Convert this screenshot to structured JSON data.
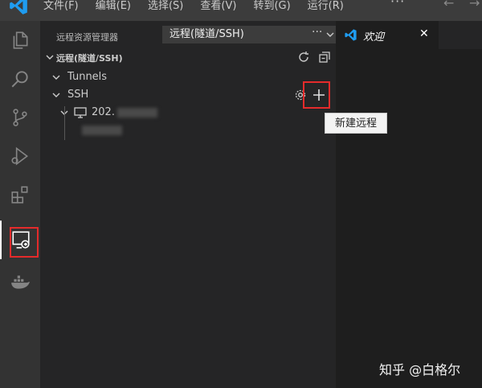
{
  "menu": [
    "文件(F)",
    "编辑(E)",
    "选择(S)",
    "查看(V)",
    "转到(G)",
    "运行(R)"
  ],
  "menu_overflow": "···",
  "activity_items": [
    "explorer-icon",
    "search-icon",
    "source-control-icon",
    "run-debug-icon",
    "extensions-icon",
    "remote-explorer-icon",
    "docker-icon"
  ],
  "annotations": {
    "step1": "1",
    "step2": "2",
    "color": "#e52b2b"
  },
  "sidebar": {
    "title": "远程资源管理器",
    "selector_value": "远程(隧道/SSH)",
    "more": "···",
    "section_title": "远程(隧道/SSH)",
    "tunnels_label": "Tunnels",
    "ssh_label": "SSH",
    "host_label": "202.",
    "add_tooltip": "新建远程"
  },
  "editor": {
    "tab_label": "欢迎",
    "tab_close": "✕"
  },
  "watermark": "知乎 @白格尔",
  "colors": {
    "accent": "#007acc",
    "activity_bg": "#333333",
    "sidebar_bg": "#252526",
    "editor_bg": "#1e1e1e"
  }
}
